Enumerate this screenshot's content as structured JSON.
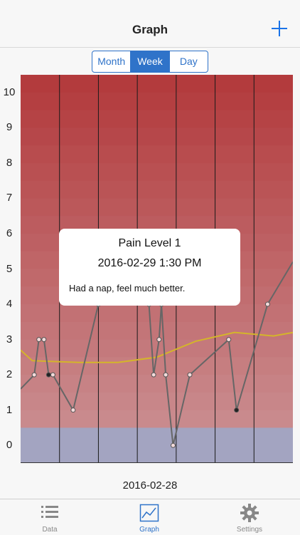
{
  "header": {
    "title": "Graph"
  },
  "segments": [
    {
      "label": "Month",
      "active": false
    },
    {
      "label": "Week",
      "active": true
    },
    {
      "label": "Day",
      "active": false
    }
  ],
  "popup": {
    "title": "Pain Level 1",
    "datetime": "2016-02-29 1:30 PM",
    "note": "Had a nap, feel much better."
  },
  "date_label": "2016-02-28",
  "tabs": [
    {
      "label": "Data",
      "icon": "list-icon",
      "active": false
    },
    {
      "label": "Graph",
      "icon": "graph-icon",
      "active": true
    },
    {
      "label": "Settings",
      "icon": "gear-icon",
      "active": false
    }
  ],
  "colors": {
    "accent": "#2f73c9",
    "zone_high": "#b33b3d",
    "zone_low": "#a3a4c1",
    "line": "#666666",
    "avg_line": "#d4b52a"
  },
  "chart_data": {
    "type": "line",
    "ylim": [
      -0.5,
      10.5
    ],
    "yticks": [
      "0",
      "1",
      "2",
      "3",
      "4",
      "5",
      "6",
      "7",
      "8",
      "9",
      "10"
    ],
    "x_range": [
      0,
      7
    ],
    "series": [
      {
        "x": [
          0.0,
          0.35,
          0.47,
          0.6,
          0.72,
          0.83,
          1.35,
          2.0,
          2.3,
          3.3,
          3.42,
          3.56,
          3.62,
          3.73,
          3.92,
          4.35,
          5.35,
          5.55,
          6.35,
          7.0
        ],
        "values": [
          1.6,
          2.0,
          3.0,
          3.0,
          2.0,
          2.0,
          1.0,
          4.0,
          5.0,
          4.0,
          2.0,
          3.0,
          4.0,
          2.0,
          0.0,
          2.0,
          3.0,
          1.0,
          4.0,
          5.2
        ]
      },
      {
        "x": [
          0.0,
          0.3,
          1.5,
          2.5,
          3.5,
          4.5,
          5.5,
          6.5,
          7.0
        ],
        "values": [
          2.7,
          2.4,
          2.35,
          2.35,
          2.5,
          2.95,
          3.2,
          3.1,
          3.2
        ]
      }
    ]
  }
}
